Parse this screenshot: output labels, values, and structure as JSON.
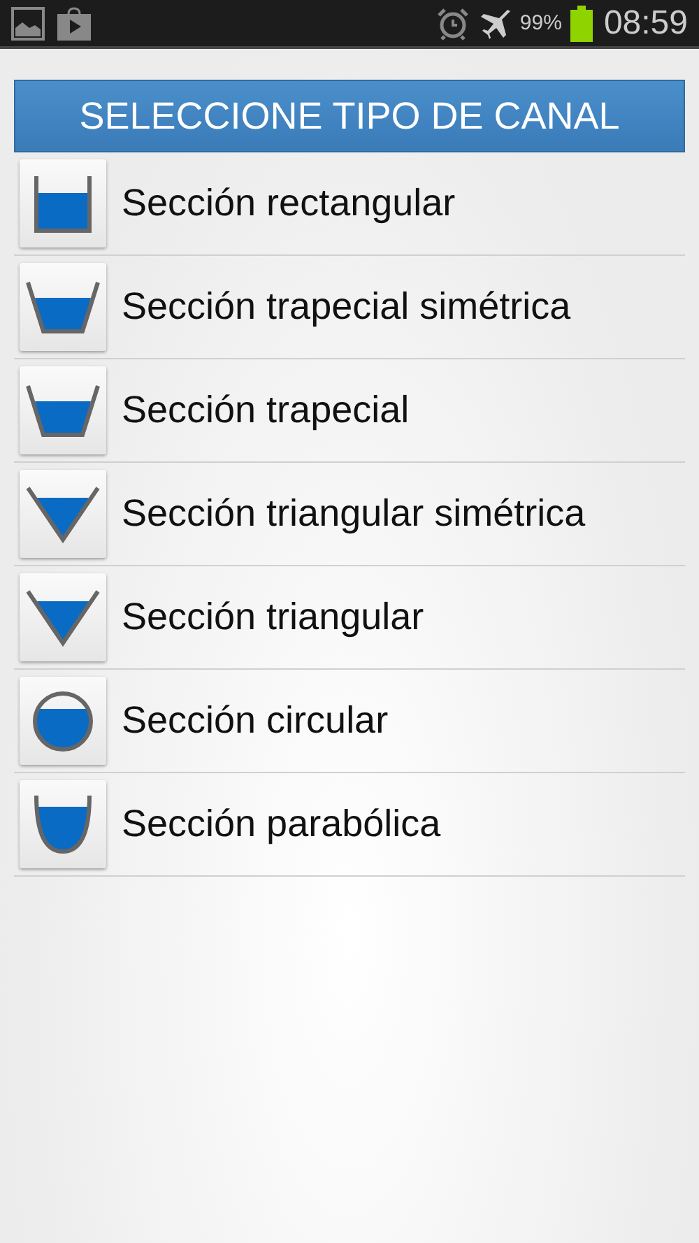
{
  "status_bar": {
    "battery": "99%",
    "time": "08:59"
  },
  "header": {
    "title": "SELECCIONE TIPO DE CANAL"
  },
  "items": [
    {
      "kind": "rectangle",
      "label": "Sección rectangular"
    },
    {
      "kind": "trapezoid",
      "label": "Sección trapecial simétrica"
    },
    {
      "kind": "trapezoid",
      "label": "Sección trapecial"
    },
    {
      "kind": "triangle",
      "label": "Sección triangular simétrica"
    },
    {
      "kind": "triangle",
      "label": "Sección triangular"
    },
    {
      "kind": "circle",
      "label": "Sección circular"
    },
    {
      "kind": "parabola",
      "label": "Sección parabólica"
    }
  ]
}
